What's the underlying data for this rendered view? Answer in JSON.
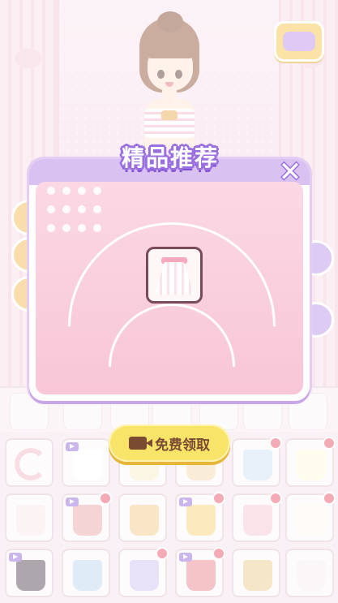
{
  "popup": {
    "title": "精品推荐",
    "close_icon": "✕",
    "claim_button_label": "免费领取"
  },
  "icons": {
    "close": "close-icon",
    "video": "video-icon",
    "reset": "reset-icon",
    "cat_badge": "cat-badge-icon"
  },
  "colors": {
    "popup_accent": "#9a6fe0",
    "claim_button": "#f8e469",
    "new_dot": "#e8455b"
  },
  "grid": {
    "rows": [
      [
        {
          "kind": "reset"
        },
        {
          "kind": "skirt",
          "video": true,
          "dot": false,
          "color": "#fff"
        },
        {
          "kind": "skirt",
          "video": false,
          "dot": false,
          "color": "#f6e8c0"
        },
        {
          "kind": "skirt",
          "video": false,
          "dot": false,
          "color": "#f3d7a6"
        },
        {
          "kind": "skirt",
          "video": false,
          "dot": true,
          "color": "#cde0f3"
        },
        {
          "kind": "skirt",
          "video": false,
          "dot": true,
          "color": "#fff6d8"
        }
      ],
      [
        {
          "kind": "skirt",
          "video": false,
          "dot": false,
          "color": "#f8e4e8"
        },
        {
          "kind": "skirt",
          "video": true,
          "dot": true,
          "color": "#e7a0a0"
        },
        {
          "kind": "skirt",
          "video": false,
          "dot": false,
          "color": "#f0c780"
        },
        {
          "kind": "skirt",
          "video": true,
          "dot": true,
          "color": "#f4d170"
        },
        {
          "kind": "skirt",
          "video": false,
          "dot": true,
          "color": "#f3c2cf"
        },
        {
          "kind": "skirt",
          "video": false,
          "dot": true,
          "color": "#fff6ec"
        }
      ],
      [
        {
          "kind": "skirt",
          "video": true,
          "dot": false,
          "color": "#4a3b48"
        },
        {
          "kind": "skirt",
          "video": false,
          "dot": false,
          "color": "#b9d3ee"
        },
        {
          "kind": "skirt",
          "video": false,
          "dot": true,
          "color": "#c9bff0"
        },
        {
          "kind": "skirt",
          "video": true,
          "dot": true,
          "color": "#e97c87"
        },
        {
          "kind": "skirt",
          "video": false,
          "dot": false,
          "color": "#e8c786"
        },
        {
          "kind": "skirt",
          "video": false,
          "dot": false,
          "color": "#f6eef0"
        }
      ]
    ]
  }
}
